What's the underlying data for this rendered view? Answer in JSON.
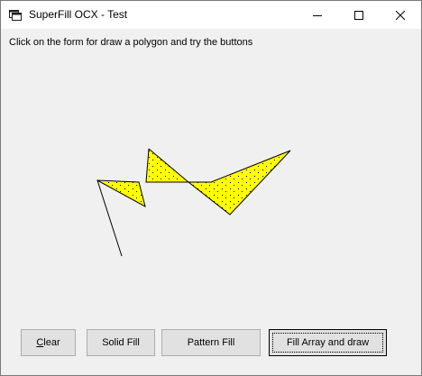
{
  "window": {
    "title": "SuperFill OCX - Test",
    "app_icon": "form-app-icon",
    "controls": {
      "minimize_icon": "minimize-icon",
      "maximize_icon": "maximize-icon",
      "close_icon": "close-icon"
    }
  },
  "form": {
    "instruction": "Click on the form for draw a polygon and try the buttons"
  },
  "drawing": {
    "fill_color": "#ffff00",
    "stroke_color": "#000000"
  },
  "buttons": {
    "clear_prefix": "C",
    "clear_rest": "lear",
    "solid_fill": "Solid Fill",
    "pattern_fill": "Pattern Fill",
    "fill_array": "Fill Array and draw"
  }
}
